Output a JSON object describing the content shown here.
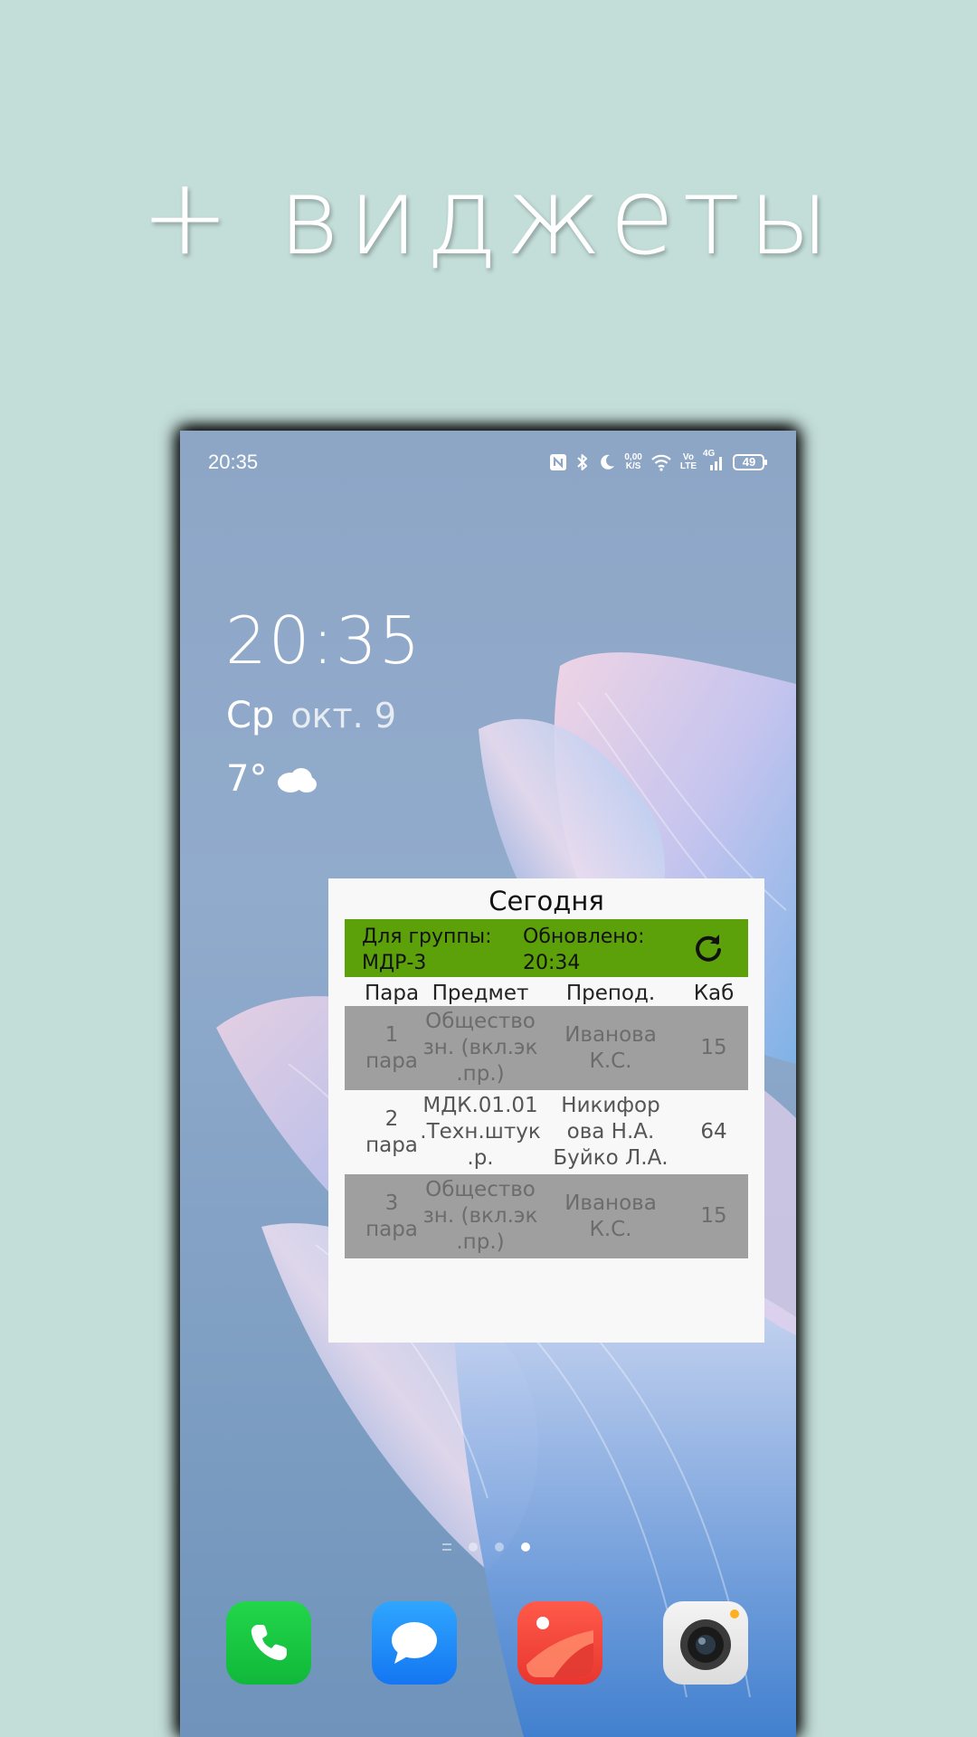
{
  "headline": "+ виджеты",
  "status_bar": {
    "time": "20:35",
    "icons": [
      "nfc-icon",
      "bluetooth-icon",
      "moon-icon",
      "speed-indicator",
      "wifi-icon",
      "volte-icon",
      "signal-4g-icon",
      "battery-icon"
    ],
    "speed_value": "0,00",
    "speed_unit": "K/S",
    "volte_top": "Vo",
    "volte_bottom": "LTE",
    "network_label": "4G",
    "battery_level": "49"
  },
  "lockscreen": {
    "clock": "20:35",
    "day": "Ср",
    "date": "окт. 9",
    "temperature": "7°",
    "weather_icon": "cloud-icon"
  },
  "widget": {
    "title": "Сегодня",
    "group_label": "Для группы:",
    "group_value": "МДР-3",
    "updated_label": "Обновлено:",
    "updated_value": "20:34",
    "refresh_icon": "refresh-icon",
    "colors": {
      "header_bar": "#5da10a",
      "grey_row": "#9f9f9f"
    },
    "columns": [
      "Пара",
      "Предмет",
      "Препод.",
      "Каб"
    ],
    "rows": [
      {
        "pair": "1\nпара",
        "subject": "Общество\nзн. (вкл.эк\n.пр.)",
        "teacher": "Иванова\nК.С.",
        "room": "15"
      },
      {
        "pair": "2\nпара",
        "subject": "МДК.01.01\n.Техн.штук\n.р.",
        "teacher": "Никифор\nова Н.А.\nБуйко Л.А.",
        "room": "64"
      },
      {
        "pair": "3\nпара",
        "subject": "Общество\nзн. (вкл.эк\n.пр.)",
        "teacher": "Иванова\nК.С.",
        "room": "15"
      }
    ]
  },
  "dock": {
    "apps": [
      "phone-app",
      "messages-app",
      "gallery-app",
      "camera-app"
    ]
  }
}
